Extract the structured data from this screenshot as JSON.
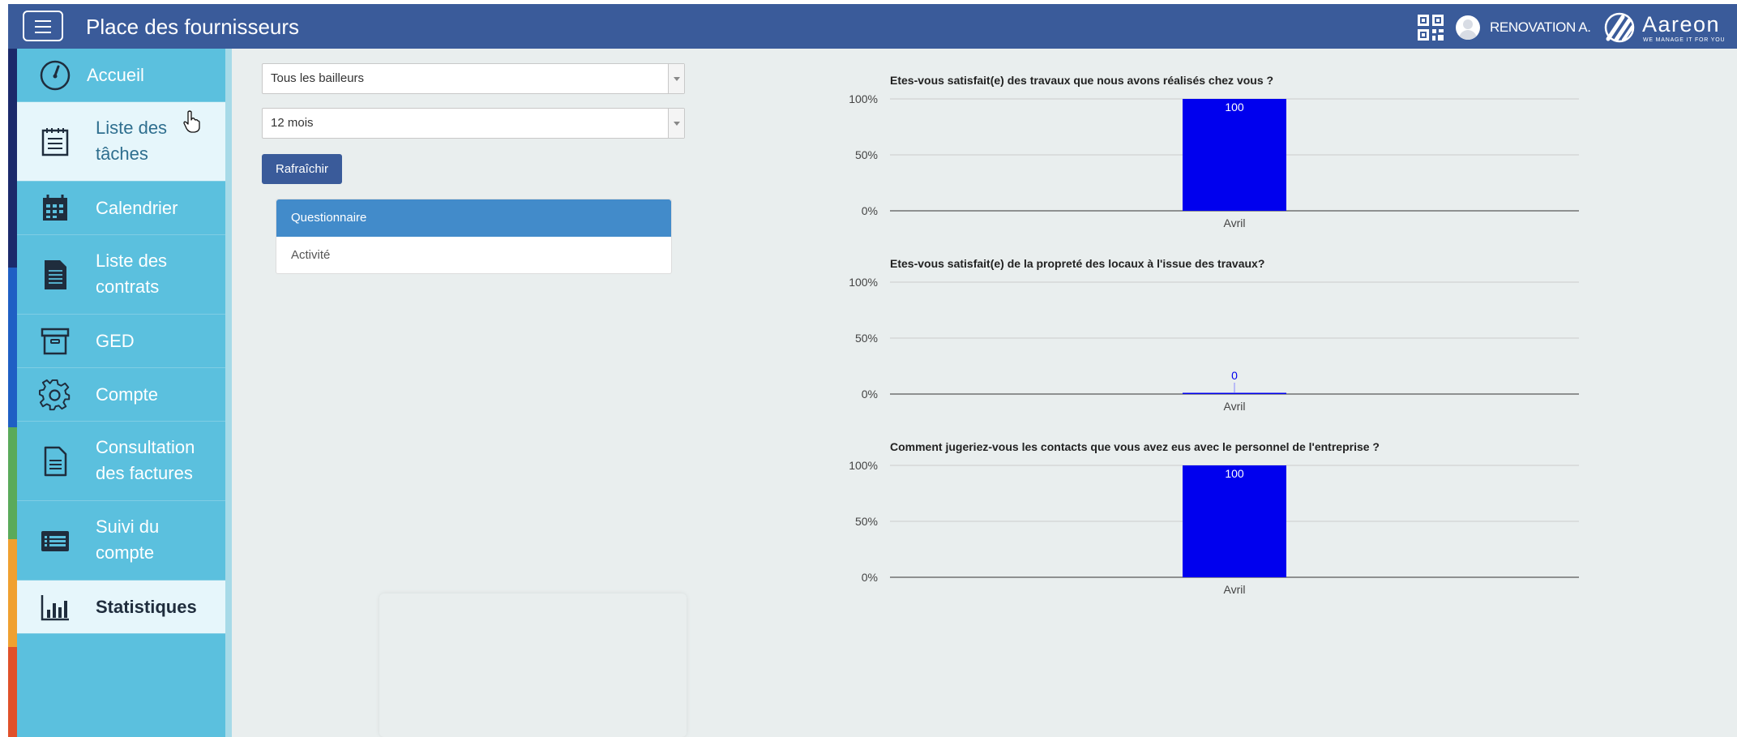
{
  "header": {
    "title": "Place des fournisseurs",
    "user_name": "RENOVATION A.",
    "brand": "Aareon",
    "brand_tagline": "WE MANAGE IT FOR YOU",
    "color": "#3a5b9a"
  },
  "sidebar": {
    "items": [
      {
        "label": "Accueil",
        "icon": "speedometer-icon"
      },
      {
        "label": "Liste des tâches",
        "icon": "task-list-icon"
      },
      {
        "label": "Calendrier",
        "icon": "calendar-icon"
      },
      {
        "label": "Liste des contrats",
        "icon": "document-icon"
      },
      {
        "label": "GED",
        "icon": "archive-box-icon"
      },
      {
        "label": "Compte",
        "icon": "gear-icon"
      },
      {
        "label": "Consultation des factures",
        "icon": "invoice-icon"
      },
      {
        "label": "Suivi du compte",
        "icon": "account-list-icon"
      },
      {
        "label": "Statistiques",
        "icon": "bar-chart-icon"
      }
    ],
    "active": "Statistiques",
    "color": "#5bc0de"
  },
  "filters": {
    "bailleur": "Tous les bailleurs",
    "period": "12 mois",
    "refresh_label": "Rafraîchir"
  },
  "tabs": {
    "items": [
      "Questionnaire",
      "Activité"
    ],
    "active": "Questionnaire"
  },
  "chart_data": [
    {
      "type": "bar",
      "title": "Etes-vous satisfait(e) des travaux que nous avons réalisés chez vous ?",
      "categories": [
        "Avril"
      ],
      "values": [
        100
      ],
      "data_labels": [
        "100"
      ],
      "yticks": [
        "100%",
        "50%",
        "0%"
      ],
      "ylim": [
        0,
        100
      ],
      "grid": true,
      "color": "#0000ee"
    },
    {
      "type": "bar",
      "title": "Etes-vous satisfait(e) de la propreté des locaux à l'issue des travaux?",
      "categories": [
        "Avril"
      ],
      "values": [
        0
      ],
      "data_labels": [
        "0"
      ],
      "yticks": [
        "100%",
        "50%",
        "0%"
      ],
      "ylim": [
        0,
        100
      ],
      "grid": true,
      "color": "#0000ee"
    },
    {
      "type": "bar",
      "title": "Comment jugeriez-vous les contacts que vous avez eus avec le personnel de l'entreprise ?",
      "categories": [
        "Avril"
      ],
      "values": [
        100
      ],
      "data_labels": [
        "100"
      ],
      "yticks": [
        "100%",
        "50%",
        "0%"
      ],
      "ylim": [
        0,
        100
      ],
      "grid": true,
      "color": "#0000ee"
    }
  ]
}
